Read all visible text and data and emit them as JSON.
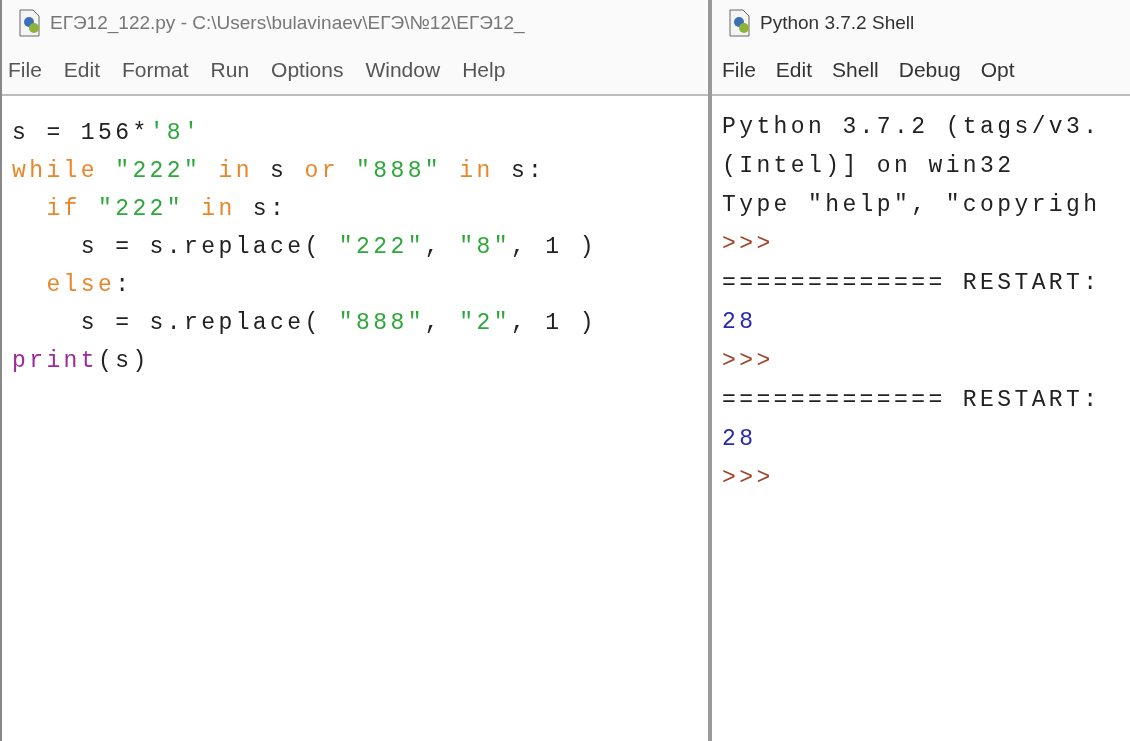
{
  "editor": {
    "title": "ЕГЭ12_122.py - C:\\Users\\bulavinaev\\ЕГЭ\\№12\\ЕГЭ12_",
    "menu": [
      "File",
      "Edit",
      "Format",
      "Run",
      "Options",
      "Window",
      "Help"
    ],
    "code_lines": [
      [
        {
          "kind": "plain",
          "text": "s = 156*"
        },
        {
          "kind": "string",
          "text": "'8'"
        }
      ],
      [
        {
          "kind": "keyword",
          "text": "while"
        },
        {
          "kind": "string",
          "text": " \"222\""
        },
        {
          "kind": "keyword",
          "text": " in"
        },
        {
          "kind": "plain",
          "text": " s"
        },
        {
          "kind": "keyword",
          "text": " or"
        },
        {
          "kind": "string",
          "text": " \"888\""
        },
        {
          "kind": "keyword",
          "text": " in"
        },
        {
          "kind": "plain",
          "text": " s:"
        }
      ],
      [
        {
          "kind": "keyword",
          "text": "  if"
        },
        {
          "kind": "string",
          "text": " \"222\""
        },
        {
          "kind": "keyword",
          "text": " in"
        },
        {
          "kind": "plain",
          "text": " s:"
        }
      ],
      [
        {
          "kind": "plain",
          "text": "    s = s.replace( "
        },
        {
          "kind": "string",
          "text": "\"222\""
        },
        {
          "kind": "plain",
          "text": ", "
        },
        {
          "kind": "string",
          "text": "\"8\""
        },
        {
          "kind": "plain",
          "text": ", 1 )"
        }
      ],
      [
        {
          "kind": "keyword",
          "text": "  else"
        },
        {
          "kind": "plain",
          "text": ":"
        }
      ],
      [
        {
          "kind": "plain",
          "text": "    s = s.replace( "
        },
        {
          "kind": "string",
          "text": "\"888\""
        },
        {
          "kind": "plain",
          "text": ", "
        },
        {
          "kind": "string",
          "text": "\"2\""
        },
        {
          "kind": "plain",
          "text": ", 1 )"
        }
      ],
      [
        {
          "kind": "builtin",
          "text": "print"
        },
        {
          "kind": "plain",
          "text": "(s)"
        }
      ]
    ]
  },
  "shell": {
    "title": "Python 3.7.2 Shell",
    "menu": [
      "File",
      "Edit",
      "Shell",
      "Debug",
      "Opt"
    ],
    "lines": [
      {
        "kind": "output",
        "text": "Python 3.7.2 (tags/v3."
      },
      {
        "kind": "output",
        "text": "(Intel)] on win32"
      },
      {
        "kind": "output",
        "text": "Type \"help\", \"copyrigh"
      },
      {
        "kind": "prompt",
        "text": ">>>"
      },
      {
        "kind": "output",
        "text": "============= RESTART:"
      },
      {
        "kind": "result",
        "text": "28"
      },
      {
        "kind": "prompt",
        "text": ">>>"
      },
      {
        "kind": "output",
        "text": "============= RESTART:"
      },
      {
        "kind": "result",
        "text": "28"
      },
      {
        "kind": "prompt",
        "text": ">>>"
      }
    ]
  }
}
